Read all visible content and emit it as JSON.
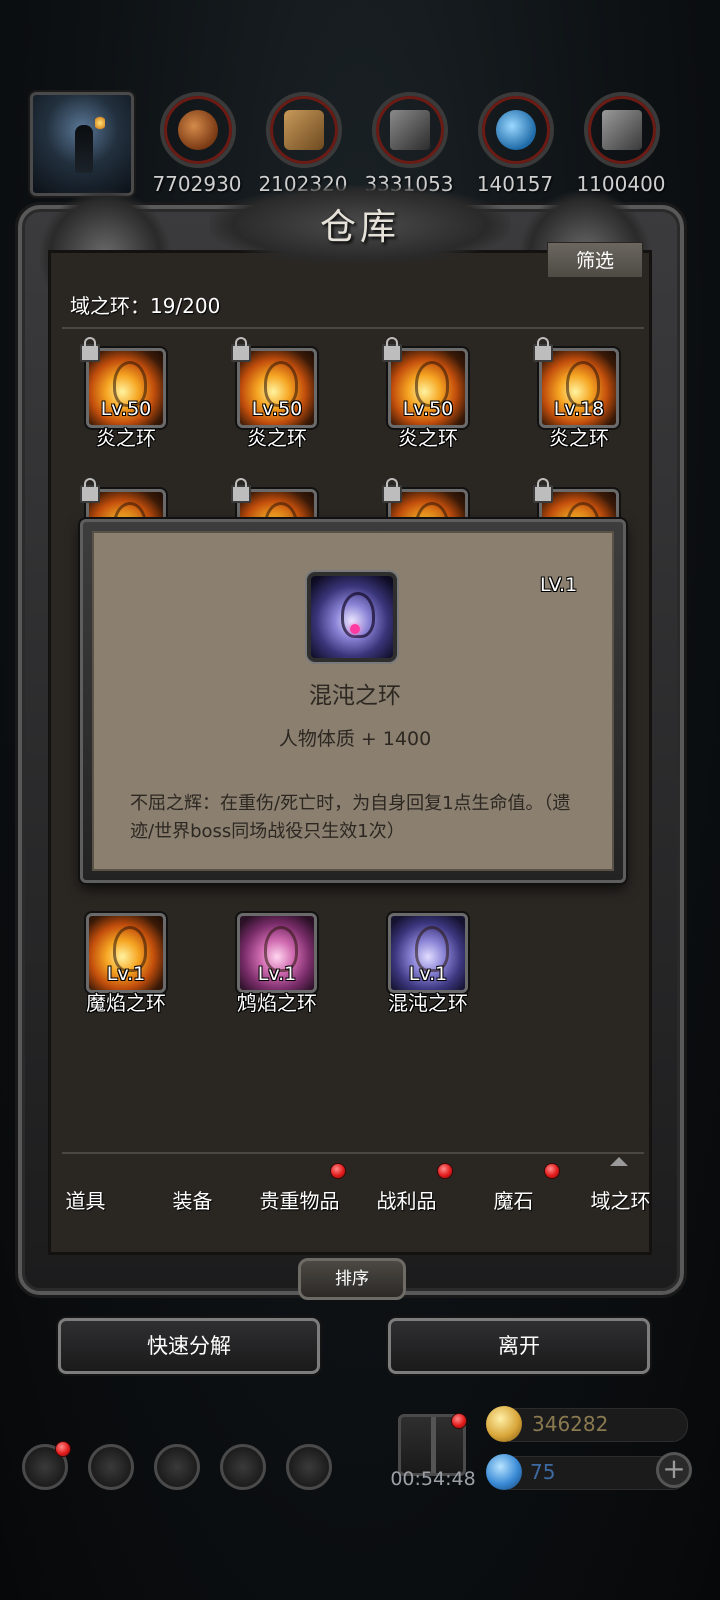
{
  "top_bar": {
    "resources": [
      {
        "icon": "ore-icon",
        "value": "7702930"
      },
      {
        "icon": "wood-icon",
        "value": "2102320"
      },
      {
        "icon": "stone-icon",
        "value": "3331053"
      },
      {
        "icon": "crystal-icon",
        "value": "140157"
      },
      {
        "icon": "iron-icon",
        "value": "1100400"
      }
    ]
  },
  "panel": {
    "title": "仓库",
    "filter_label": "筛选",
    "category_count": "域之环：19/200"
  },
  "grid": {
    "row1": [
      {
        "level": "Lv.50",
        "name": "炎之环",
        "color": "fire",
        "locked": true
      },
      {
        "level": "Lv.50",
        "name": "炎之环",
        "color": "fire",
        "locked": true
      },
      {
        "level": "Lv.50",
        "name": "炎之环",
        "color": "fire",
        "locked": true
      },
      {
        "level": "Lv.18",
        "name": "炎之环",
        "color": "fire",
        "locked": true
      }
    ],
    "row_last": [
      {
        "level": "Lv.1",
        "name": "魔焰之环",
        "color": "fire"
      },
      {
        "level": "Lv.1",
        "name": "鸩焰之环",
        "color": "pink"
      },
      {
        "level": "Lv.1",
        "name": "混沌之环",
        "color": "violet"
      }
    ]
  },
  "tooltip": {
    "level": "LV.1",
    "name": "混沌之环",
    "stat": "人物体质 + 1400",
    "description": "不屈之辉：在重伤/死亡时，为自身回复1点生命值。（遗迹/世界boss同场战役只生效1次）"
  },
  "tabs": [
    {
      "label": "道具",
      "badge": false
    },
    {
      "label": "装备",
      "badge": false
    },
    {
      "label": "贵重物品",
      "badge": true
    },
    {
      "label": "战利品",
      "badge": true
    },
    {
      "label": "魔石",
      "badge": true
    },
    {
      "label": "域之环",
      "badge": false,
      "active": true
    }
  ],
  "buttons": {
    "sort": "排序",
    "quick_decompose": "快速分解",
    "leave": "离开"
  },
  "hud": {
    "timer": "00:54:48",
    "gold": "346282",
    "gems": "75"
  },
  "colors": {
    "badge_red": "#e21b1b",
    "tooltip_bg": "#8b8070",
    "panel_bg": "#2a2723"
  }
}
